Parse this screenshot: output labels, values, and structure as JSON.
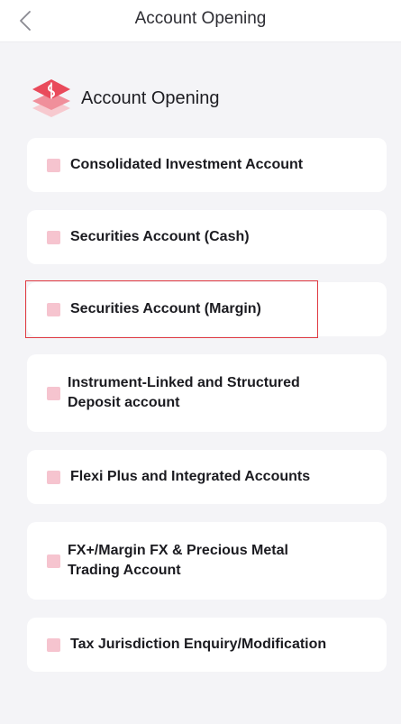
{
  "header": {
    "title": "Account Opening"
  },
  "section": {
    "title": "Account Opening"
  },
  "items": [
    {
      "label": "Consolidated Investment Account"
    },
    {
      "label": "Securities Account (Cash)"
    },
    {
      "label": "Securities Account (Margin)"
    },
    {
      "label": "Instrument-Linked and Structured Deposit account"
    },
    {
      "label": "Flexi Plus and Integrated Accounts"
    },
    {
      "label": "FX+/Margin FX & Precious Metal Trading Account"
    },
    {
      "label": "Tax Jurisdiction Enquiry/Modification"
    }
  ],
  "colors": {
    "accent": "#e94a5b",
    "marker": "#f6c4cf",
    "highlight": "#e03a42",
    "background": "#f4f4f7"
  },
  "icons": {
    "back": "chevron-left-icon",
    "logo": "stacked-layers-logo-icon"
  }
}
